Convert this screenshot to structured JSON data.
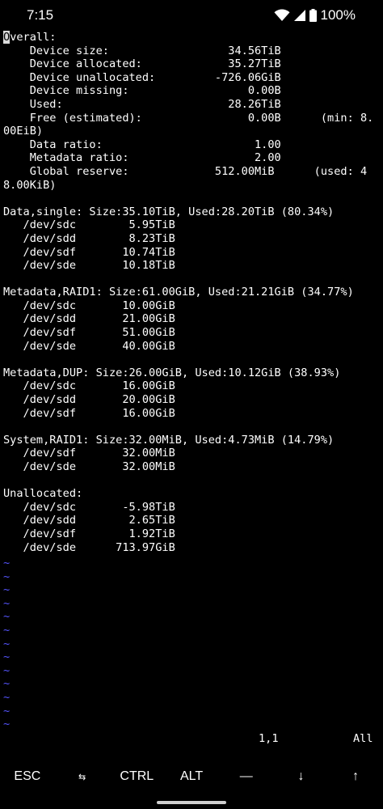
{
  "status_bar": {
    "time": "7:15",
    "battery": "100%",
    "icons": [
      "wifi-icon",
      "signal-icon",
      "battery-icon"
    ]
  },
  "terminal": {
    "cursor_char": "O",
    "lines": [
      "verall:",
      "    Device size:                  34.56TiB",
      "    Device allocated:             35.27TiB",
      "    Device unallocated:         -726.06GiB",
      "    Device missing:                  0.00B",
      "    Used:                         28.26TiB",
      "    Free (estimated):                0.00B      (min: 8.",
      "00EiB)",
      "    Data ratio:                       1.00",
      "    Metadata ratio:                   2.00",
      "    Global reserve:             512.00MiB      (used: 4",
      "8.00KiB)",
      "",
      "Data,single: Size:35.10TiB, Used:28.20TiB (80.34%)",
      "   /dev/sdc        5.95TiB",
      "   /dev/sdd        8.23TiB",
      "   /dev/sdf       10.74TiB",
      "   /dev/sde       10.18TiB",
      "",
      "Metadata,RAID1: Size:61.00GiB, Used:21.21GiB (34.77%)",
      "   /dev/sdc       10.00GiB",
      "   /dev/sdd       21.00GiB",
      "   /dev/sdf       51.00GiB",
      "   /dev/sde       40.00GiB",
      "",
      "Metadata,DUP: Size:26.00GiB, Used:10.12GiB (38.93%)",
      "   /dev/sdc       16.00GiB",
      "   /dev/sdd       20.00GiB",
      "   /dev/sdf       16.00GiB",
      "",
      "System,RAID1: Size:32.00MiB, Used:4.73MiB (14.79%)",
      "   /dev/sdf       32.00MiB",
      "   /dev/sde       32.00MiB",
      "",
      "Unallocated:",
      "   /dev/sdc       -5.98TiB",
      "   /dev/sdd        2.65TiB",
      "   /dev/sdf        1.92TiB",
      "   /dev/sde      713.97GiB"
    ],
    "empty_line_marker": "~",
    "ruler_position": "1,1",
    "ruler_percent": "All"
  },
  "extra_keys": [
    {
      "label": "ESC",
      "name": "esc-key"
    },
    {
      "label": "⇆",
      "name": "tab-key"
    },
    {
      "label": "CTRL",
      "name": "ctrl-key"
    },
    {
      "label": "ALT",
      "name": "alt-key"
    },
    {
      "label": "—",
      "name": "dash-key"
    },
    {
      "label": "↓",
      "name": "arrow-down-key"
    },
    {
      "label": "↑",
      "name": "arrow-up-key"
    }
  ]
}
